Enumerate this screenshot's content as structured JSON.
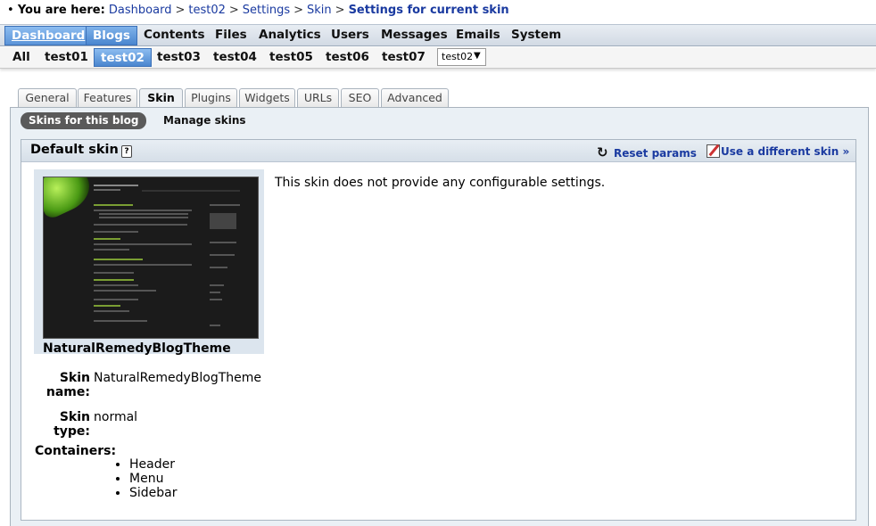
{
  "breadcrumb": {
    "prefix": "You are here:",
    "items": [
      "Dashboard",
      "test02",
      "Settings",
      "Skin"
    ],
    "current": "Settings for current skin"
  },
  "main_menu": [
    "Dashboard",
    "Blogs",
    "Contents",
    "Files",
    "Analytics",
    "Users",
    "Messages",
    "Emails",
    "System"
  ],
  "blog_tabs": [
    "All",
    "test01",
    "test02",
    "test03",
    "test04",
    "test05",
    "test06",
    "test07"
  ],
  "blog_select": {
    "selected": "test02"
  },
  "settings_tabs": [
    "General",
    "Features",
    "Skin",
    "Plugins",
    "Widgets",
    "URLs",
    "SEO",
    "Advanced"
  ],
  "sub_tabs": [
    "Skins for this blog",
    "Manage skins"
  ],
  "fieldset": {
    "title": "Default skin",
    "reset_label": "Reset params",
    "different_label": "Use a different skin »"
  },
  "skin": {
    "name": "NaturalRemedyBlogTheme",
    "no_settings_msg": "This skin does not provide any configurable settings.",
    "name_label_1": "Skin",
    "name_label_2": "name:",
    "type_label_1": "Skin",
    "type_label_2": "type:",
    "type": "normal",
    "containers_label": "Containers:",
    "containers": [
      "Header",
      "Menu",
      "Sidebar"
    ]
  },
  "colors": {
    "link": "#1a3aa0",
    "active_tab": "#4a86cf",
    "panel_bg": "#eaf0f5"
  }
}
